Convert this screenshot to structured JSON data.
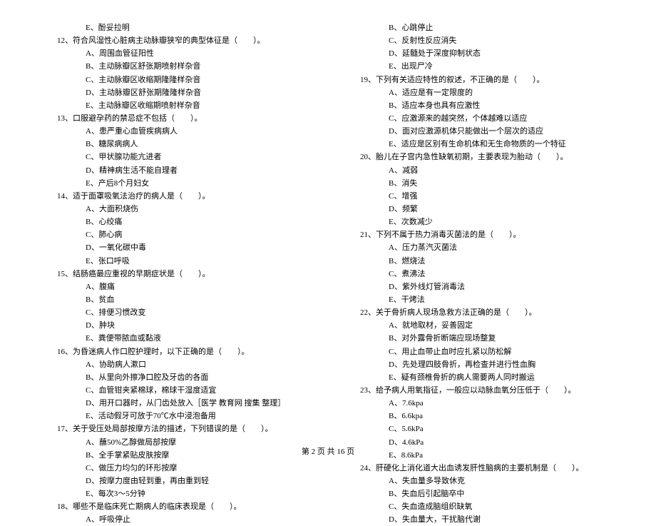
{
  "col1": {
    "l0": "E、酚妥拉明",
    "q12": "12、符合风湿性心脏病主动脉瓣狭窄的典型体征是（　　）。",
    "q12a": "A、周围血管征阳性",
    "q12b": "B、主动脉瓣区舒张期喷射样杂音",
    "q12c": "C、主动脉瓣区收缩期隆隆样杂音",
    "q12d": "D、主动脉瓣区舒张期隆隆样杂音",
    "q12e": "E、主动脉瓣区收缩期喷射样杂音",
    "q13": "13、口服避孕药的禁忌症不包括（　　）。",
    "q13a": "A、患严重心血管疾病病人",
    "q13b": "B、糖尿病病人",
    "q13c": "C、甲状腺功能亢进者",
    "q13d": "D、精神病生活不能自理者",
    "q13e": "E、产后8个月妇女",
    "q14": "14、适于面罩吸氧法治疗的病人是（　　）。",
    "q14a": "A、大面积烧伤",
    "q14b": "B、心绞痛",
    "q14c": "C、肺心病",
    "q14d": "D、一氧化碳中毒",
    "q14e": "E、张口呼吸",
    "q15": "15、结肠癌最应重视的早期症状是（　　）。",
    "q15a": "A、腹痛",
    "q15b": "B、贫血",
    "q15c": "C、排便习惯改变",
    "q15d": "D、肿块",
    "q15e": "E、粪便带脓血或黏液",
    "q16": "16、为昏迷病人作口腔护理时，以下正确的是（　　）。",
    "q16a": "A、协助病人漱口",
    "q16b": "B、从里向外擦净口腔及牙齿的各面",
    "q16c": "C、血管钳夹紧棉球，棉球干湿度适宜",
    "q16d": "D、用开口器时，从门齿处放入［医学 教育网 搜集 整理］",
    "q16e": "E、活动假牙可放于70℃水中浸泡备用",
    "q17": "17、关于受压处局部按摩方法的描述，下列错误的是（　　）。",
    "q17a": "A、蘸50%乙醇做局部按摩",
    "q17b": "B、全手掌紧贴皮肤按摩",
    "q17c": "C、做压力均匀的环形按摩",
    "q17d": "D、按摩力度由轻到重，再由重到轻",
    "q17e": "E、每次3～5分钟",
    "q18": "18、哪些不是临床死亡期病人的临床表现是（　　）。",
    "q18a": "A、呼吸停止"
  },
  "col2": {
    "q18b": "B、心跳停止",
    "q18c": "C、反射性反应消失",
    "q18d": "D、延髓处于深度抑制状态",
    "q18e": "E、出现尸冷",
    "q19": "19、下列有关适应特性的叙述，不正确的是（　　）。",
    "q19a": "A、适应是有一定限度的",
    "q19b": "B、适应本身也具有应激性",
    "q19c": "C、应激源来的越突然，个体越难以适应",
    "q19d": "D、面对应激源机体只能做出一个层次的适应",
    "q19e": "E、适应是区别有生命机体和无生命物质的一个特征",
    "q20": "20、胎儿在子宫内急性缺氧初期，主要表现为胎动（　　）。",
    "q20a": "A、减弱",
    "q20b": "B、消失",
    "q20c": "C、增强",
    "q20d": "D、频繁",
    "q20e": "E、次数减少",
    "q21": "21、下列不属于热力消毒灭菌法的是（　　）。",
    "q21a": "A、压力蒸汽灭菌法",
    "q21b": "B、燃烧法",
    "q21c": "C、煮沸法",
    "q21d": "D、紫外线灯管消毒法",
    "q21e": "E、干烤法",
    "q22": "22、关于骨折病人现场急救方法正确的是（　　）。",
    "q22a": "A、就地取材，妥善固定",
    "q22b": "B、对外露骨折断端应现场整复",
    "q22c": "C、用止血带止血时应扎紧以防松解",
    "q22d": "D、先处理四肢骨折，再检查并进行性血胸",
    "q22e": "E、疑有颈椎骨折的病人需要两人同时搬运",
    "q23": "23、给予病人用氧指征，一般应以动脉血氧分压低于（　　）。",
    "q23a": "A、7.6kpa",
    "q23b": "B、6.6kpa",
    "q23c": "C、5.6kPa",
    "q23d": "D、4.6kPa",
    "q23e": "E、8.6kPa",
    "q24": "24、肝硬化上消化道大出血诱发肝性脑病的主要机制是（　　）。",
    "q24a": "A、失血量多导致休克",
    "q24b": "B、失血后引起脑卒中",
    "q24c": "C、失血造成脑组织缺氧",
    "q24d": "D、失血量大，干扰脑代谢"
  },
  "footer": "第 2 页 共 16 页"
}
